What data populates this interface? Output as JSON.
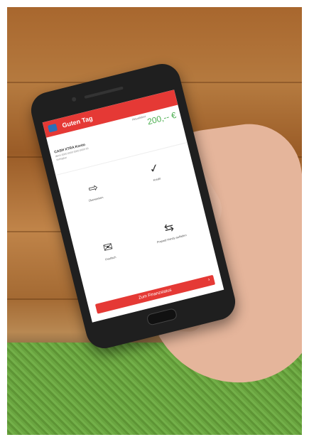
{
  "app": {
    "header": {
      "greeting": "Guten Tag"
    },
    "account": {
      "refresh_text": "Aktualisiert",
      "balance": "200,-- €",
      "name": "CASH XTRA Konto",
      "line1": "IBAN 0000 0000 0000 0000 00",
      "line2": "Verfügbar"
    },
    "tiles": [
      {
        "label": "Überweisen",
        "icon": "transfer-icon"
      },
      {
        "label": "Kredit",
        "icon": "check-icon"
      },
      {
        "label": "Postfach",
        "icon": "mail-icon"
      },
      {
        "label": "Prepaid Handy aufladen",
        "icon": "phone-topup-icon"
      }
    ],
    "cta": {
      "label": "Zum Finanzstatus"
    }
  },
  "colors": {
    "primary": "#e53935",
    "balance": "#4caf50",
    "menu": "#2d6fb7"
  }
}
